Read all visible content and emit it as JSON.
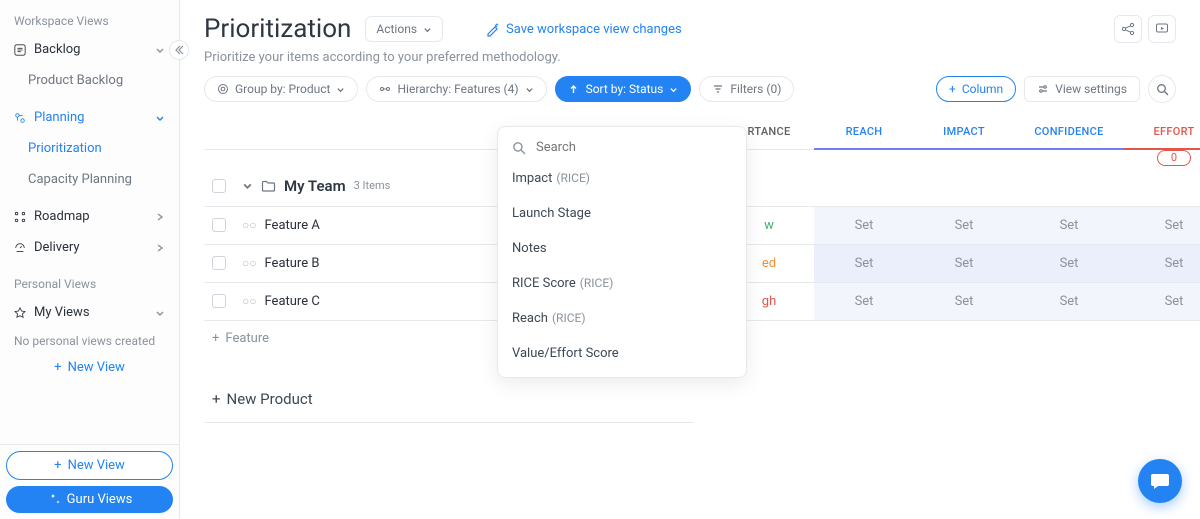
{
  "sidebar": {
    "section_ws": "Workspace Views",
    "backlog": "Backlog",
    "product_backlog": "Product Backlog",
    "planning": "Planning",
    "prioritization": "Prioritization",
    "capacity": "Capacity Planning",
    "roadmap": "Roadmap",
    "delivery": "Delivery",
    "section_pv": "Personal Views",
    "my_views": "My Views",
    "empty_msg": "No personal views created",
    "new_view": "New View",
    "guru": "Guru Views"
  },
  "header": {
    "title": "Prioritization",
    "actions": "Actions",
    "save": "Save workspace view changes",
    "subtitle": "Prioritize your items according to your preferred methodology."
  },
  "toolbar": {
    "group_by": "Group by: Product",
    "hierarchy": "Hierarchy: Features (4)",
    "sort_by": "Sort by: Status",
    "filters": "Filters (0)",
    "column": "Column",
    "view_settings": "View settings"
  },
  "dropdown": {
    "search_ph": "Search",
    "items": [
      {
        "label": "Impact",
        "sub": "(RICE)"
      },
      {
        "label": "Launch Stage",
        "sub": ""
      },
      {
        "label": "Notes",
        "sub": ""
      },
      {
        "label": "RICE Score",
        "sub": "(RICE)"
      },
      {
        "label": "Reach",
        "sub": "(RICE)"
      },
      {
        "label": "Value/Effort Score",
        "sub": ""
      }
    ]
  },
  "grid": {
    "group_name": "My Team",
    "group_count": "3 Items",
    "cols": {
      "importance": "RTANCE",
      "reach": "REACH",
      "impact": "IMPACT",
      "confidence": "CONFIDENCE",
      "effort": "EFFORT"
    },
    "effort_badge": "0",
    "rows": [
      {
        "name": "Feature A",
        "prio": "w",
        "prio_cls": "prio-low"
      },
      {
        "name": "Feature B",
        "prio": "ed",
        "prio_cls": "prio-med"
      },
      {
        "name": "Feature C",
        "prio": "gh",
        "prio_cls": "prio-high"
      }
    ],
    "set": "Set",
    "add_feature": "Feature",
    "add_product": "New Product"
  }
}
